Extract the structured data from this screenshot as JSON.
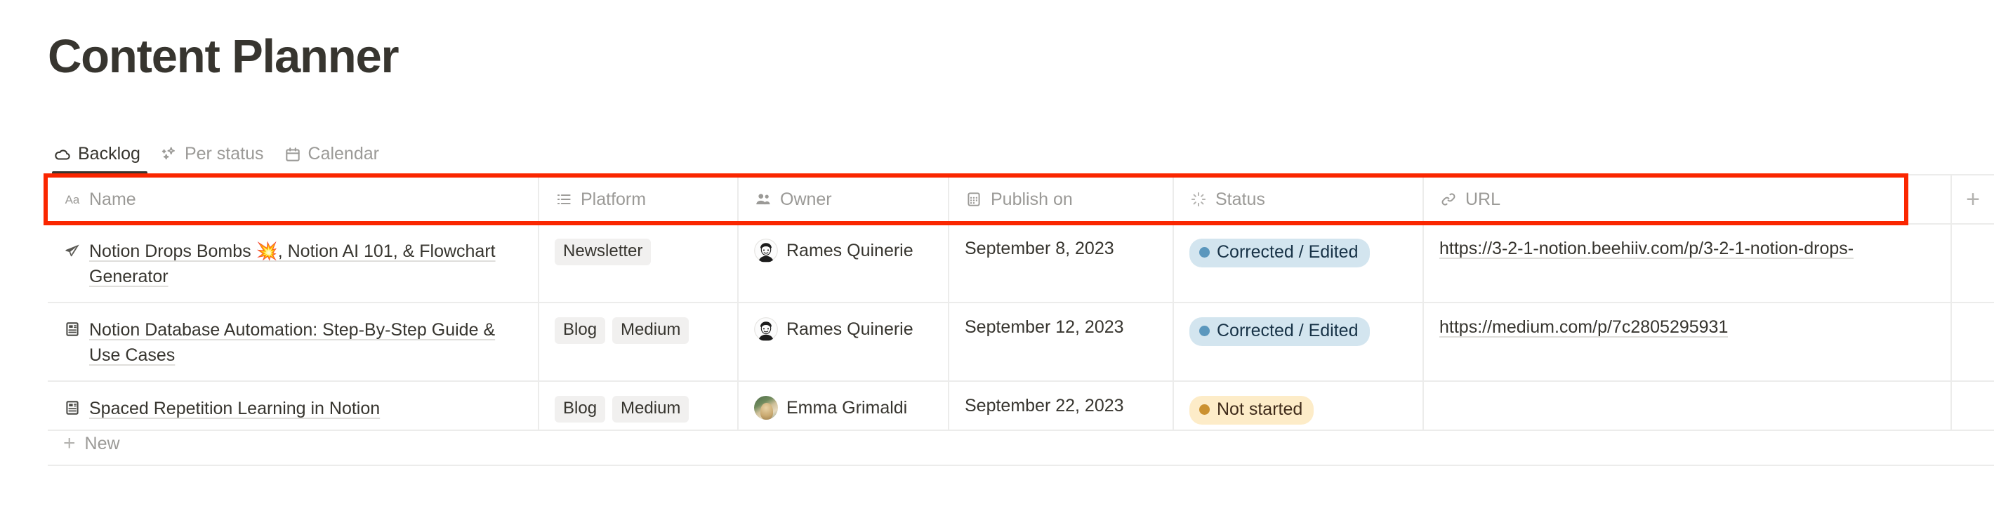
{
  "header": {
    "title": "Content Planner"
  },
  "tabs": [
    {
      "label": "Backlog",
      "icon": "cloud-icon",
      "active": true
    },
    {
      "label": "Per status",
      "icon": "sparkles-icon",
      "active": false
    },
    {
      "label": "Calendar",
      "icon": "calendar-icon",
      "active": false
    }
  ],
  "table": {
    "columns": [
      {
        "label": "Name",
        "icon": "text-aa-icon"
      },
      {
        "label": "Platform",
        "icon": "multi-select-list-icon"
      },
      {
        "label": "Owner",
        "icon": "people-icon"
      },
      {
        "label": "Publish on",
        "icon": "date-calendar-icon"
      },
      {
        "label": "Status",
        "icon": "status-spinner-icon"
      },
      {
        "label": "URL",
        "icon": "link-icon"
      }
    ],
    "add_column_label": "+",
    "rows": [
      {
        "name": "Notion Drops Bombs 💥, Notion AI 101, & Flowchart Generator",
        "name_icon": "paper-plane-icon",
        "platform": [
          "Newsletter"
        ],
        "owner": "Rames Quinerie",
        "owner_avatar": "cartoon-face-avatar",
        "publish_on": "September 8, 2023",
        "status": "Corrected / Edited",
        "status_color": "#d3e5ef",
        "status_dot_color": "#5b97bd",
        "url": "https://3-2-1-notion.beehiiv.com/p/3-2-1-notion-drops-"
      },
      {
        "name": "Notion Database Automation: Step-By-Step Guide & Use Cases",
        "name_icon": "article-page-icon",
        "platform": [
          "Blog",
          "Medium"
        ],
        "owner": "Rames Quinerie",
        "owner_avatar": "cartoon-face-avatar",
        "publish_on": "September 12, 2023",
        "status": "Corrected / Edited",
        "status_color": "#d3e5ef",
        "status_dot_color": "#5b97bd",
        "url": "https://medium.com/p/7c2805295931"
      },
      {
        "name": "Spaced Repetition Learning in Notion",
        "name_icon": "article-page-icon",
        "platform": [
          "Blog",
          "Medium"
        ],
        "owner": "Emma Grimaldi",
        "owner_avatar": "photo-avatar",
        "publish_on": "September 22, 2023",
        "status": "Not started",
        "status_color": "#fdecc8",
        "status_dot_color": "#cb912f",
        "url": ""
      }
    ],
    "new_row_label": "New"
  },
  "annotation": {
    "highlight_color": "#fa2600"
  }
}
